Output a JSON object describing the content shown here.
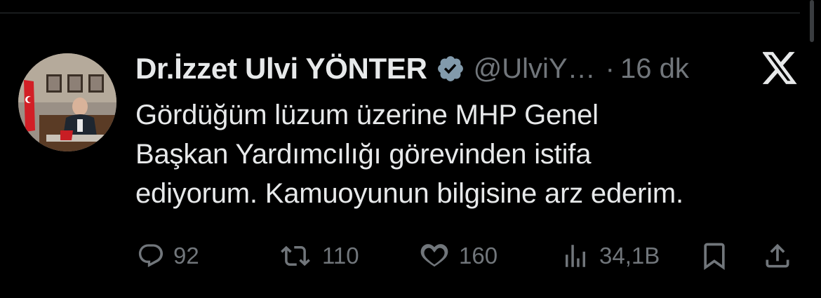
{
  "author": {
    "display_name": "Dr.İzzet Ulvi YÖNTER",
    "handle": "@UlviYönter",
    "separator": "·",
    "time": "16 dk",
    "verified": true
  },
  "tweet": {
    "lines": [
      "Gördüğüm lüzum üzerine MHP Genel",
      "Başkan Yardımcılığı görevinden istifa",
      "ediyorum. Kamuoyunun bilgisine arz ederim."
    ]
  },
  "actions": {
    "replies": "92",
    "reposts": "110",
    "likes": "160",
    "views": "34,1B"
  },
  "icons": {
    "reply": "reply-icon",
    "repost": "repost-icon",
    "like": "heart-icon",
    "views": "views-icon",
    "bookmark": "bookmark-icon",
    "share": "share-icon",
    "brand": "x-logo-icon"
  },
  "colors": {
    "background": "#000000",
    "text": "#e7e9ea",
    "muted": "#71767b",
    "badge": "#829aab"
  }
}
